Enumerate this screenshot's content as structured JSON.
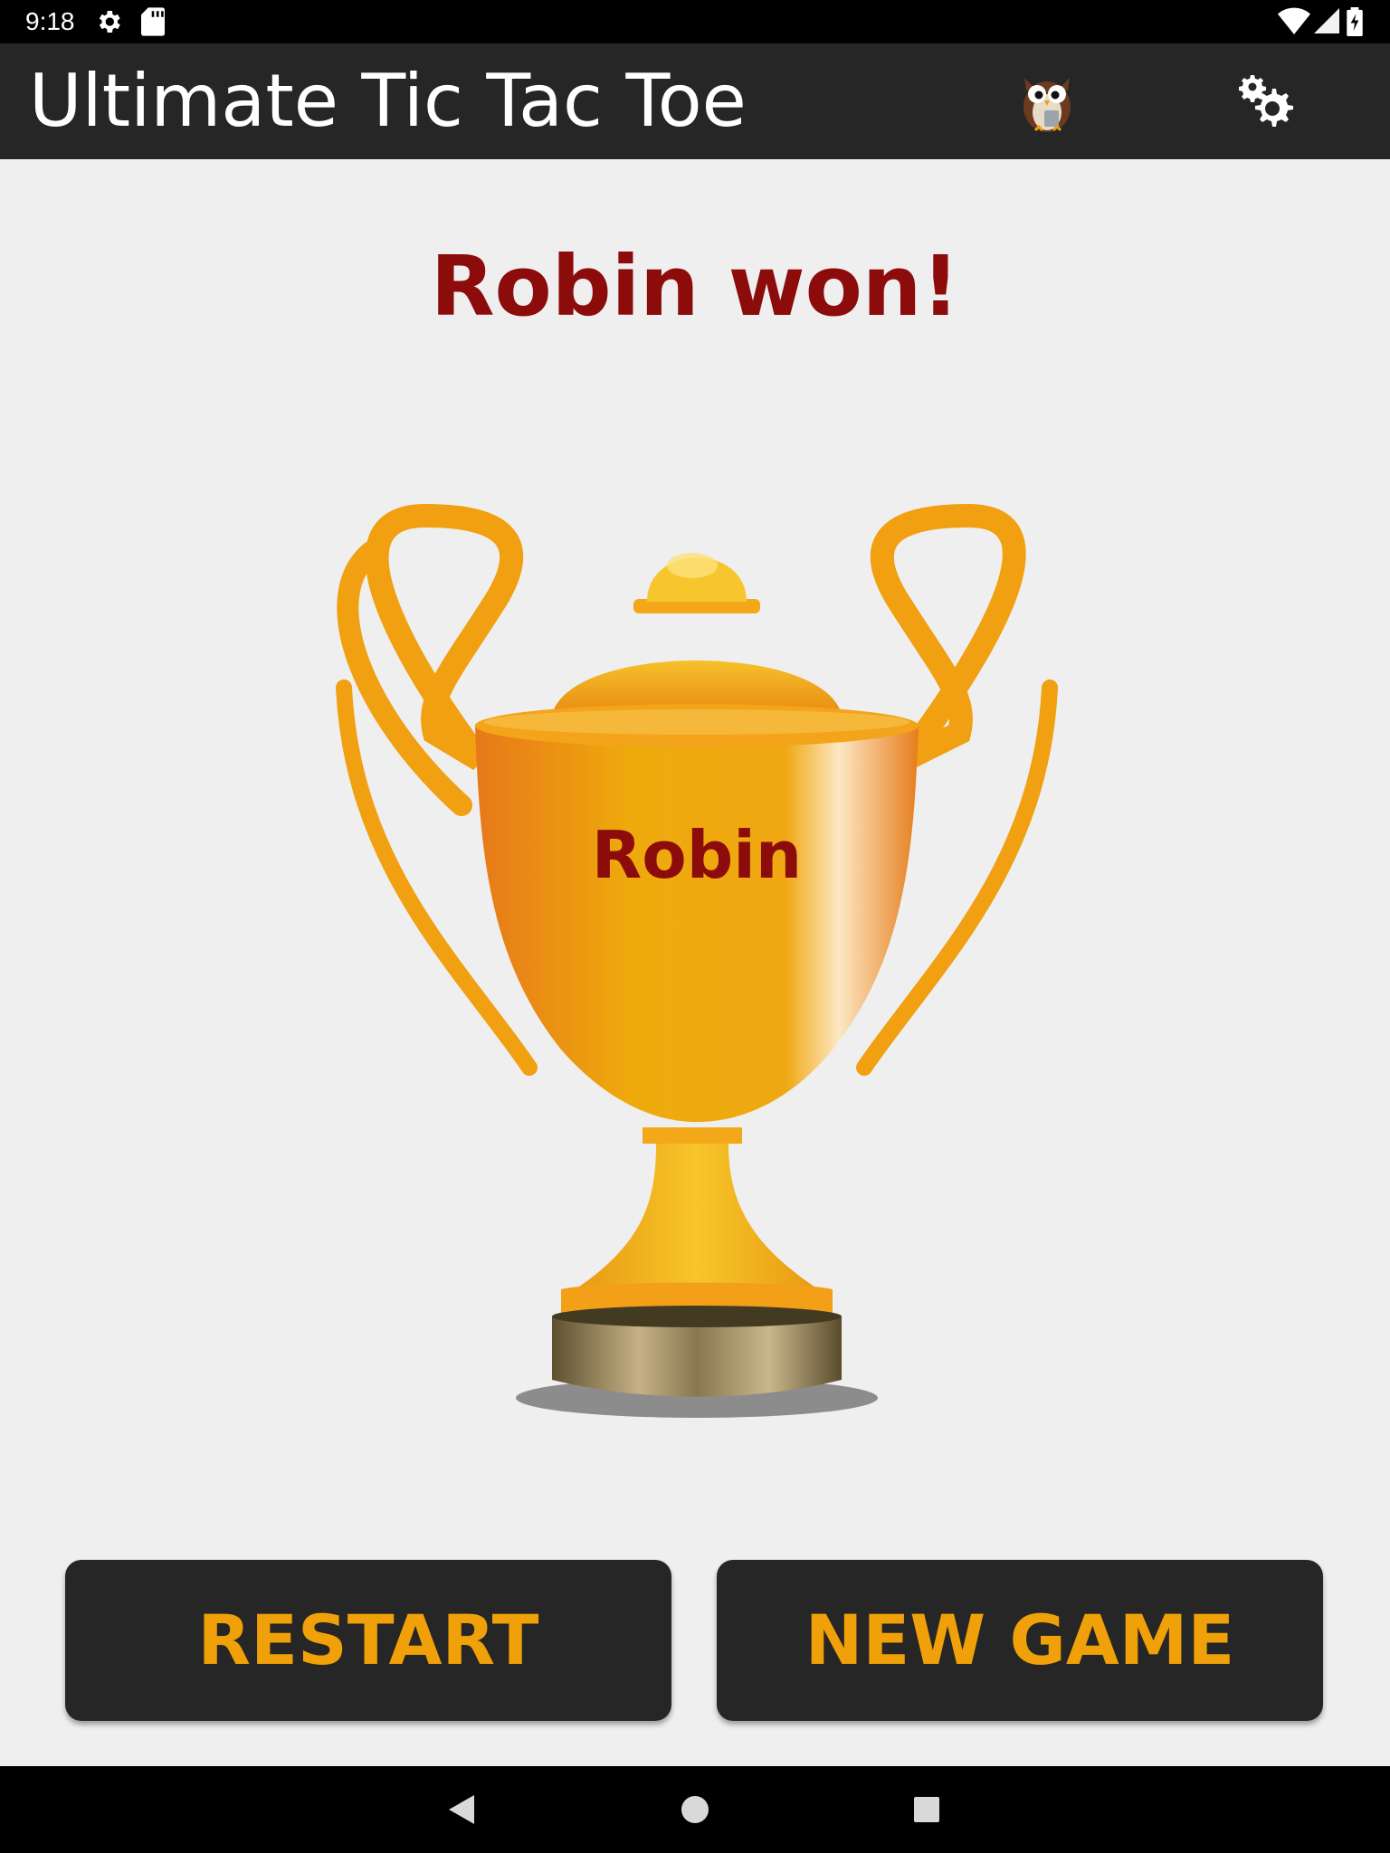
{
  "status_bar": {
    "time": "9:18",
    "icons": [
      "settings-icon",
      "sd-card-icon",
      "wifi-icon",
      "signal-icon",
      "battery-icon"
    ]
  },
  "app_bar": {
    "title": "Ultimate Tic Tac Toe",
    "actions": [
      "owl-icon",
      "settings-icon"
    ]
  },
  "result": {
    "title": "Robin won!",
    "trophy_name": "Robin"
  },
  "buttons": {
    "restart_label": "RESTART",
    "new_game_label": "NEW GAME"
  },
  "nav_bar": {
    "buttons": [
      "back-icon",
      "home-icon",
      "recents-icon"
    ]
  },
  "colors": {
    "app_bar": "#262626",
    "background": "#efefef",
    "winner_text": "#8c0b0b",
    "button_text": "#f0a008",
    "trophy_gold": "#f0a010"
  }
}
